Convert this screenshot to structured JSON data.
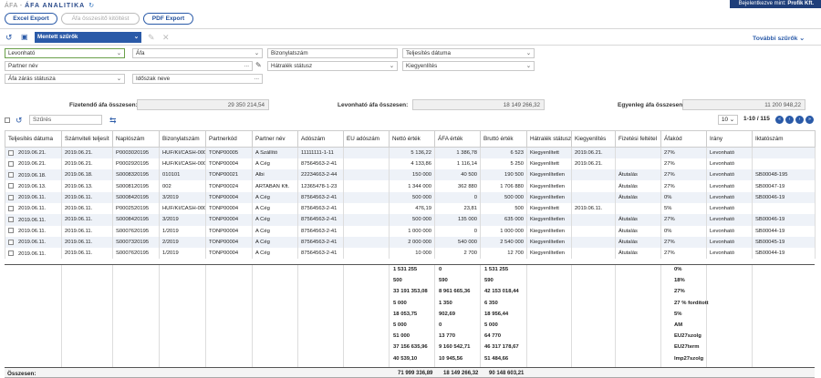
{
  "breadcrumb": {
    "parent": "ÁFA",
    "current": "ÁFA ANALITIKA"
  },
  "login": {
    "prefix": "Bejelentkezve mint:",
    "user": "Profik Kft."
  },
  "toolbar": {
    "excel": "Excel Export",
    "afa": "Áfa összesítő kitöltést",
    "pdf": "PDF Export"
  },
  "saved_filters": "Mentett szűrők",
  "more_filters": "További szűrők",
  "filters": {
    "type": "Levonható",
    "afa": "Áfa",
    "biz": "Bizonylatszám",
    "telj": "Teljesítés dátuma",
    "partner": "Partner név",
    "hatralek": "Hátralék státusz",
    "kiegy": "Kiegyenlítés",
    "zaras": "Áfa zárás státusza",
    "idoszak": "Időszak neve"
  },
  "sums": {
    "fiz_label": "Fizetendő áfa összesen:",
    "fiz": "29 350 214,54",
    "lev_label": "Levonható áfa összesen:",
    "lev": "18 149 266,32",
    "egy_label": "Egyenleg áfa összesen:",
    "egy": "11 200 948,22"
  },
  "search_placeholder": "Szűrés",
  "paging": {
    "per_page": "10",
    "range": "1-10 / 115"
  },
  "columns": [
    "Teljesítés dátuma",
    "Számviteli teljesít",
    "Naplószám",
    "Bizonylatszám",
    "Partnerkód",
    "Partner név",
    "Adószám",
    "EU adószám",
    "Nettó érték",
    "ÁFA érték",
    "Bruttó érték",
    "Hátralék státusz",
    "Kiegyenlítés",
    "Fizetési feltétel",
    "Áfakód",
    "Irány",
    "Iktatószám"
  ],
  "rows": [
    [
      "2019.06.21.",
      "2019.06.21.",
      "P0003020195",
      "HUF/KI/CASH-000",
      "TONP00005",
      "A Szállító",
      "11111111-1-11",
      "",
      "5 136,22",
      "1 386,78",
      "6 523",
      "Kiegyenlített",
      "2019.06.21.",
      "",
      "27%",
      "Levonható",
      ""
    ],
    [
      "2019.06.21.",
      "2019.06.21.",
      "P0002920195",
      "HUF/KI/CASH-000",
      "TONP00004",
      "A Cég",
      "87564563-2-41",
      "",
      "4 133,86",
      "1 116,14",
      "5 250",
      "Kiegyenlített",
      "2019.06.21.",
      "",
      "27%",
      "Levonható",
      ""
    ],
    [
      "2019.06.18.",
      "2019.06.18.",
      "S0008320195",
      "010101",
      "TONP00021",
      "Albi",
      "22234663-2-44",
      "",
      "150 000",
      "40 500",
      "190 500",
      "Kiegyenlítetlen",
      "",
      "Átutalás",
      "27%",
      "Levonható",
      "SB00048-195"
    ],
    [
      "2019.06.13.",
      "2019.06.13.",
      "S0008120195",
      "002",
      "TONP00024",
      "ARTABAN Kft.",
      "12365478-1-23",
      "",
      "1 344 000",
      "362 880",
      "1 706 880",
      "Kiegyenlítetlen",
      "",
      "Átutalás",
      "27%",
      "Levonható",
      "SB00047-19"
    ],
    [
      "2019.06.11.",
      "2019.06.11.",
      "S0008420195",
      "3/2019",
      "TONP00004",
      "A Cég",
      "87564563-2-41",
      "",
      "500 000",
      "0",
      "500 000",
      "Kiegyenlítetlen",
      "",
      "Átutalás",
      "0%",
      "Levonható",
      "SB00046-19"
    ],
    [
      "2019.06.11.",
      "2019.06.11.",
      "P0002520195",
      "HUF/KI/CASH-000",
      "TONP00004",
      "A Cég",
      "87564563-2-41",
      "",
      "476,19",
      "23,81",
      "500",
      "Kiegyenlített",
      "2019.06.11.",
      "",
      "5%",
      "Levonható",
      ""
    ],
    [
      "2019.06.11.",
      "2019.06.11.",
      "S0008420195",
      "3/2019",
      "TONP00004",
      "A Cég",
      "87564563-2-41",
      "",
      "500 000",
      "135 000",
      "635 000",
      "Kiegyenlítetlen",
      "",
      "Átutalás",
      "27%",
      "Levonható",
      "SB00046-19"
    ],
    [
      "2019.06.11.",
      "2019.06.11.",
      "S0007620195",
      "1/2019",
      "TONP00004",
      "A Cég",
      "87564563-2-41",
      "",
      "1 000 000",
      "0",
      "1 000 000",
      "Kiegyenlítetlen",
      "",
      "Átutalás",
      "0%",
      "Levonható",
      "SB00044-19"
    ],
    [
      "2019.06.11.",
      "2019.06.11.",
      "S0007320195",
      "2/2019",
      "TONP00004",
      "A Cég",
      "87564563-2-41",
      "",
      "2 000 000",
      "540 000",
      "2 540 000",
      "Kiegyenlítetlen",
      "",
      "Átutalás",
      "27%",
      "Levonható",
      "SB00045-19"
    ],
    [
      "2019.06.11.",
      "2019.06.11.",
      "S0007620195",
      "1/2019",
      "TONP00004",
      "A Cég",
      "87564563-2-41",
      "",
      "10 000",
      "2 700",
      "12 700",
      "Kiegyenlítetlen",
      "",
      "Átutalás",
      "27%",
      "Levonható",
      "SB00044-19"
    ]
  ],
  "aggregates": [
    [
      "1 531 255",
      "0",
      "1 531 255",
      "0%"
    ],
    [
      "500",
      "590",
      "590",
      "18%"
    ],
    [
      "33 191 353,08",
      "8 961 665,36",
      "42 153 018,44",
      "27%"
    ],
    [
      "5 000",
      "1 350",
      "6 350",
      "27 % fordított"
    ],
    [
      "18 053,75",
      "902,69",
      "18 956,44",
      "5%"
    ],
    [
      "5 000",
      "0",
      "5 000",
      "AM"
    ],
    [
      "51 000",
      "13 770",
      "64 770",
      "EU27szolg"
    ],
    [
      "37 156 635,96",
      "9 160 542,71",
      "46 317 178,67",
      "EU27term"
    ],
    [
      "40 539,10",
      "10 945,56",
      "51 484,66",
      "Imp27szolg"
    ]
  ],
  "total": {
    "label": "Összesen:",
    "netto": "71 999 336,89",
    "afa": "18 149 266,32",
    "brutto": "90 148 603,21"
  }
}
